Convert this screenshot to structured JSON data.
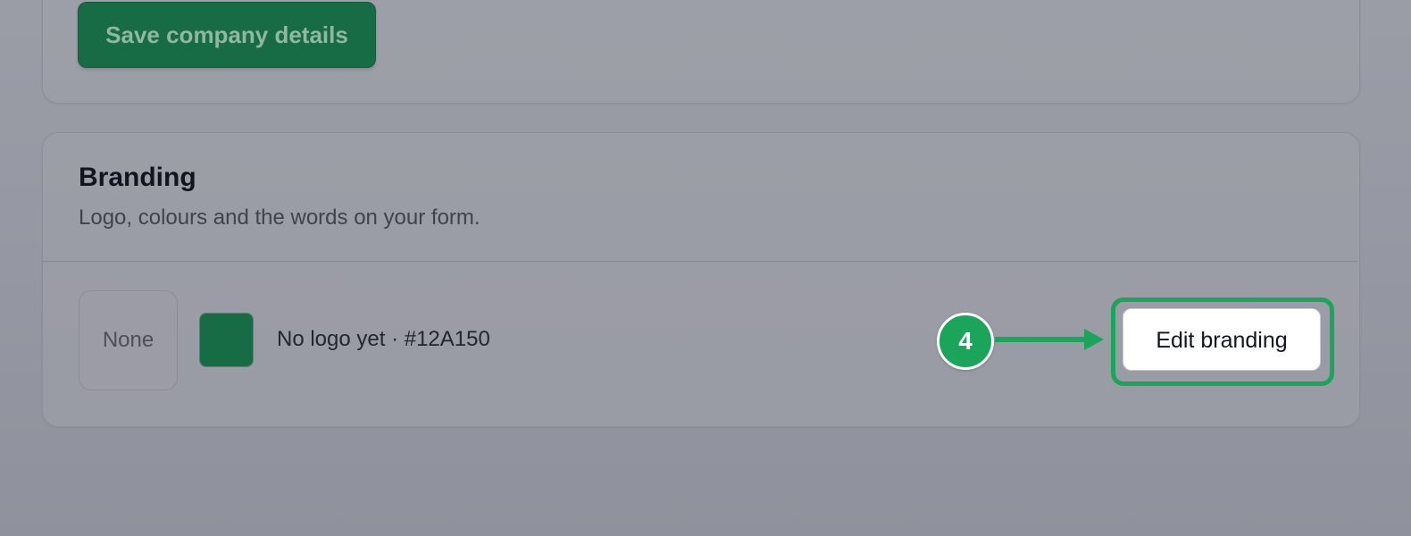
{
  "company_section": {
    "save_label": "Save company details"
  },
  "branding": {
    "title": "Branding",
    "subtitle": "Logo, colours and the words on your form.",
    "logo_placeholder": "None",
    "brand_color": "#12A150",
    "swatch_color": "#176b45",
    "summary": "No logo yet · #12A150",
    "edit_label": "Edit branding"
  },
  "annotation": {
    "step_number": "4",
    "badge_color": "#1aa55a",
    "arrow_color": "#1aa55a",
    "target": "Edit branding"
  },
  "colors": {
    "overlay_background": "#9597a2",
    "primary_green": "#176b45",
    "highlight_green": "#1aa55a"
  }
}
